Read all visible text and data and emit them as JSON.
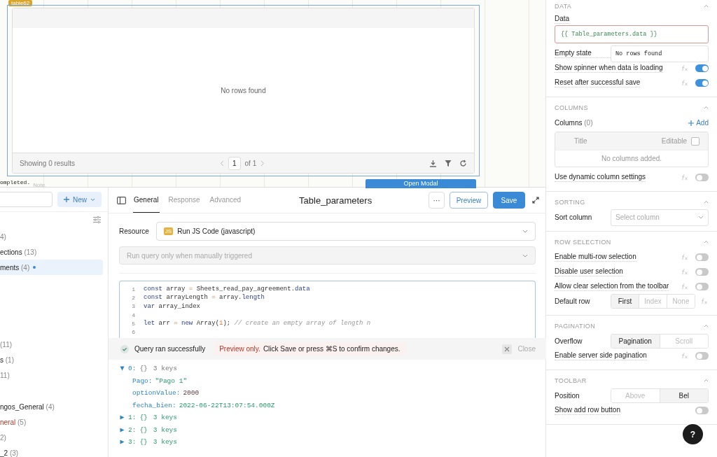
{
  "canvas": {
    "widget_tag": "table62",
    "table": {
      "empty_text": "No rows found",
      "footer": "Showing 0 results",
      "page": "1",
      "page_total": "of 1"
    },
    "log_text": "ompleted.",
    "note": "Note.",
    "modal_button": "Open Modal"
  },
  "sidebar": {
    "new_button": "New",
    "groups": [
      [
        {
          "count": "4)",
          "selected": false,
          "unsaved": false
        },
        {
          "name": "ections",
          "count": "(13)",
          "selected": false,
          "unsaved": false,
          "error": false
        },
        {
          "name": "ments",
          "count": "(4)",
          "selected": true,
          "unsaved": true,
          "error": false
        }
      ],
      [
        {
          "count": "(11)",
          "selected": false,
          "unsaved": false
        },
        {
          "name": "s",
          "count": "(1)",
          "selected": false,
          "unsaved": false,
          "error": false
        },
        {
          "count": "11)",
          "selected": false,
          "unsaved": false
        }
      ],
      [
        {
          "name": "ngos_General",
          "count": "(4)",
          "selected": false,
          "unsaved": false,
          "error": false
        },
        {
          "name": "neral",
          "count": "(5)",
          "selected": false,
          "unsaved": false,
          "error": true
        },
        {
          "count": "2)",
          "selected": false,
          "unsaved": false
        },
        {
          "name": "_2",
          "count": "(3)",
          "selected": false,
          "unsaved": false,
          "error": false
        }
      ]
    ]
  },
  "editor": {
    "tabs": [
      {
        "label": "General",
        "selected": true
      },
      {
        "label": "Response",
        "selected": false
      },
      {
        "label": "Advanced",
        "selected": false
      }
    ],
    "title": "Table_parameters",
    "more_button": "···",
    "preview_button": "Preview",
    "save_button": "Save",
    "resource": {
      "label": "Resource",
      "badge": "JS",
      "value": "Run JS Code (javascript)"
    },
    "trigger": {
      "value": "Run query only when manually triggered",
      "disabled": true
    },
    "code": [
      {
        "num": "1",
        "tokens": [
          {
            "kind": "kw",
            "text": "const"
          },
          {
            "kind": "id",
            "text": " array "
          },
          {
            "kind": "op",
            "text": "="
          },
          {
            "kind": "id",
            "text": " Sheets_read_pay_agreement."
          },
          {
            "kind": "prop",
            "text": "data"
          }
        ]
      },
      {
        "num": "2",
        "tokens": [
          {
            "kind": "kw",
            "text": "const"
          },
          {
            "kind": "id",
            "text": " arrayLength "
          },
          {
            "kind": "op",
            "text": "="
          },
          {
            "kind": "id",
            "text": " array."
          },
          {
            "kind": "prop",
            "text": "length"
          }
        ]
      },
      {
        "num": "3",
        "tokens": [
          {
            "kind": "kw",
            "text": "var"
          },
          {
            "kind": "id",
            "text": " array_index"
          }
        ]
      },
      {
        "num": "4"
      },
      {
        "num": "5",
        "tokens": [
          {
            "kind": "kw",
            "text": "let"
          },
          {
            "kind": "id",
            "text": " arr "
          },
          {
            "kind": "op",
            "text": "="
          },
          {
            "kind": "kw",
            "text": " new"
          },
          {
            "kind": "id",
            "text": " Array("
          },
          {
            "kind": "num",
            "text": "1"
          },
          {
            "kind": "id",
            "text": "); "
          },
          {
            "kind": "comment",
            "text": "// create an empty array of length n"
          }
        ]
      },
      {
        "num": "6"
      }
    ],
    "status": {
      "message": "Query ran successfully",
      "warning": "Preview only.",
      "hint": "Click Save or press  ⌘S to confirm changes.",
      "close": "Close"
    },
    "output": [
      {
        "index": "0:",
        "type": "{}",
        "summary": "3 keys",
        "expanded": true,
        "children": [
          {
            "key": "Pago:",
            "value": "\"Pago 1\"",
            "kind": "string"
          },
          {
            "key": "optionValue:",
            "value": "2000",
            "kind": "number"
          },
          {
            "key": "fecha_bien:",
            "value": "2022-06-22T13:07:54.000Z",
            "kind": "string"
          }
        ]
      },
      {
        "index": "1:",
        "type": "{}",
        "summary": "3 keys",
        "expanded": false
      },
      {
        "index": "2:",
        "type": "{}",
        "summary": "3 keys",
        "expanded": false
      },
      {
        "index": "3:",
        "type": "{}",
        "summary": "3 keys",
        "expanded": false
      }
    ]
  },
  "inspector": {
    "help_button": "?",
    "sections": [
      {
        "title": "DATA",
        "expanded": true,
        "rows": [
          {
            "kind": "label",
            "label": "Data"
          },
          {
            "kind": "code",
            "value": "{{ Table_parameters.data }}",
            "error": true
          },
          {
            "kind": "input",
            "label": "Empty state",
            "value": "No rows found"
          },
          {
            "kind": "toggle",
            "label": "Show spinner when data is loading",
            "fx": true,
            "on": true
          },
          {
            "kind": "toggle",
            "label": "Reset after successful save",
            "fx": true,
            "on": true
          }
        ]
      },
      {
        "title": "COLUMNS",
        "expanded": true,
        "rows": [
          {
            "kind": "count",
            "label": "Columns",
            "count": "(0)",
            "link": "Add"
          },
          {
            "kind": "table",
            "title": "Title",
            "editable": "Editable",
            "checked": false,
            "empty": "No columns added."
          },
          {
            "kind": "toggle",
            "label": "Use dynamic column settings",
            "fx": true,
            "on": false
          }
        ]
      },
      {
        "title": "SORTING",
        "expanded": true,
        "rows": [
          {
            "kind": "select",
            "label": "Sort column",
            "placeholder": "Select column"
          }
        ]
      },
      {
        "title": "ROW SELECTION",
        "expanded": true,
        "rows": [
          {
            "kind": "toggle",
            "label": "Enable multi-row selection",
            "fx": true,
            "on": false
          },
          {
            "kind": "toggle",
            "label": "Disable user selection",
            "fx": true,
            "on": false
          },
          {
            "kind": "toggle",
            "label": "Allow clear selection from the toolbar",
            "fx": true,
            "on": false
          },
          {
            "kind": "segmented",
            "label": "Default row",
            "fx": true,
            "options": [
              {
                "label": "First",
                "selected": true
              },
              {
                "label": "Index",
                "selected": false
              },
              {
                "label": "None",
                "selected": false
              }
            ]
          }
        ]
      },
      {
        "title": "PAGINATION",
        "expanded": true,
        "rows": [
          {
            "kind": "segmented",
            "label": "Overflow",
            "fx": false,
            "options": [
              {
                "label": "Pagination",
                "selected": true
              },
              {
                "label": "Scroll",
                "selected": false
              }
            ]
          },
          {
            "kind": "toggle",
            "label": "Enable server side pagination",
            "fx": true,
            "on": false
          }
        ]
      },
      {
        "title": "TOOLBAR",
        "expanded": true,
        "rows": [
          {
            "kind": "segmented",
            "label": "Position",
            "fx": false,
            "options": [
              {
                "label": "Above",
                "selected": false
              },
              {
                "label": "Bel",
                "selected": true
              }
            ]
          },
          {
            "kind": "toggle",
            "label": "Show add row button",
            "fx": false,
            "on": false
          }
        ]
      }
    ]
  }
}
